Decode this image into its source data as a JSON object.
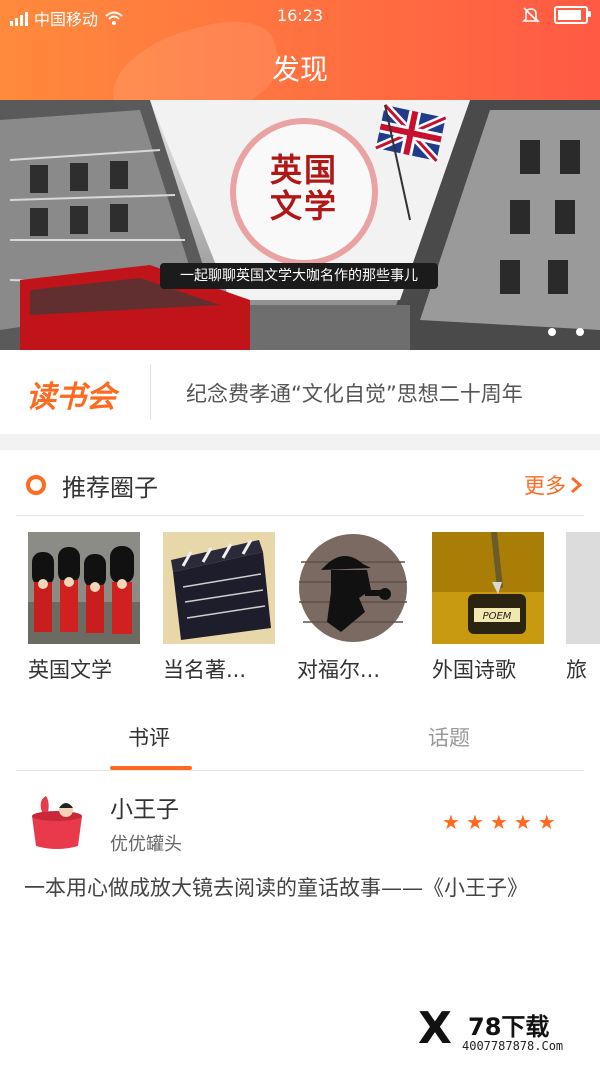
{
  "status_bar": {
    "carrier": "中国移动",
    "time": "16:23",
    "battery_level": 0.9
  },
  "header": {
    "title": "发现"
  },
  "banner": {
    "title_line1": "英国",
    "title_line2": "文学",
    "subtitle": "一起聊聊英国文学大咖名作的那些事儿",
    "page_count": 2
  },
  "reading_club": {
    "logo": "读书会",
    "headline": "纪念费孝通“文化自觉”思想二十周年"
  },
  "recommended": {
    "title": "推荐圈子",
    "more_label": "更多",
    "items": [
      {
        "label": "英国文学"
      },
      {
        "label": "当名著..."
      },
      {
        "label": "对福尔..."
      },
      {
        "label": "外国诗歌"
      },
      {
        "label": "旅"
      }
    ]
  },
  "tabs": {
    "active": "书评",
    "inactive": "话题"
  },
  "review": {
    "book_title": "小王子",
    "user_name": "优优罐头",
    "rating": 5,
    "rating_max": 5,
    "excerpt": "一本用心做成放大镜去阅读的童话故事——《小王子》"
  },
  "watermark": {
    "brand": "78下载",
    "sub": "4007787878.Com"
  },
  "colors": {
    "accent": "#ff6a20",
    "header_start": "#ff8a3c",
    "header_end": "#ff5a44"
  }
}
